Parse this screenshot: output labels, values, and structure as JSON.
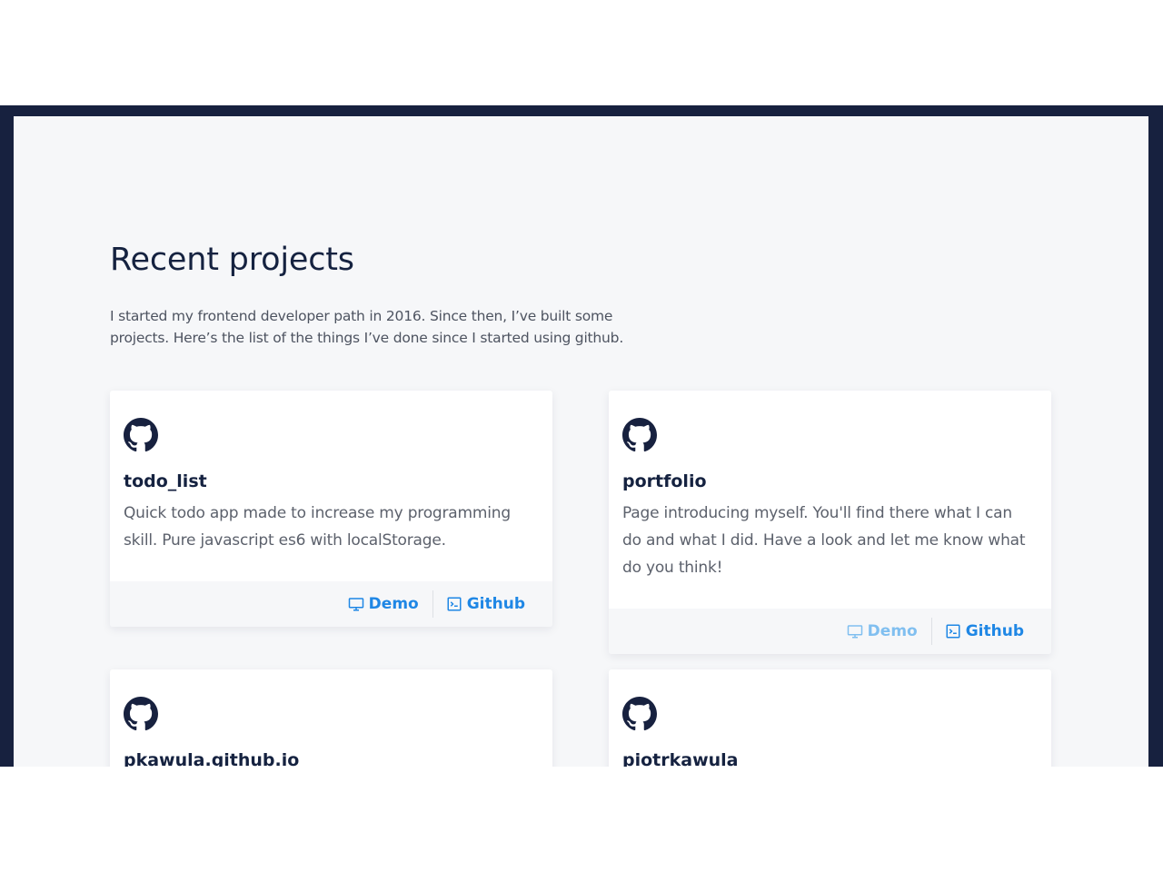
{
  "section": {
    "title": "Recent projects",
    "intro": "I started my frontend developer path in 2016. Since then, I’ve built some projects. Here’s the list of the things I’ve done since I started using github."
  },
  "icons": {
    "repo": "github-icon",
    "demo": "monitor-icon",
    "source": "terminal-icon"
  },
  "colors": {
    "frame": "#17213f",
    "background": "#f6f7f9",
    "heading": "#152240",
    "link": "#1f87e5",
    "link_muted": "#80bff0"
  },
  "projects": [
    {
      "name": "todo_list",
      "description": "Quick todo app made to increase my programming skill. Pure javascript es6 with localStorage.",
      "demo_label": "Demo",
      "github_label": "Github"
    },
    {
      "name": "portfolio",
      "description": "Page introducing myself. You'll find there what I can do and what I did. Have a look and let me know what do you think!",
      "demo_label": "Demo",
      "github_label": "Github"
    },
    {
      "name": "pkawula.github.io",
      "description": "",
      "demo_label": "",
      "github_label": ""
    },
    {
      "name": "piotrkawula",
      "description": "",
      "demo_label": "",
      "github_label": ""
    }
  ]
}
